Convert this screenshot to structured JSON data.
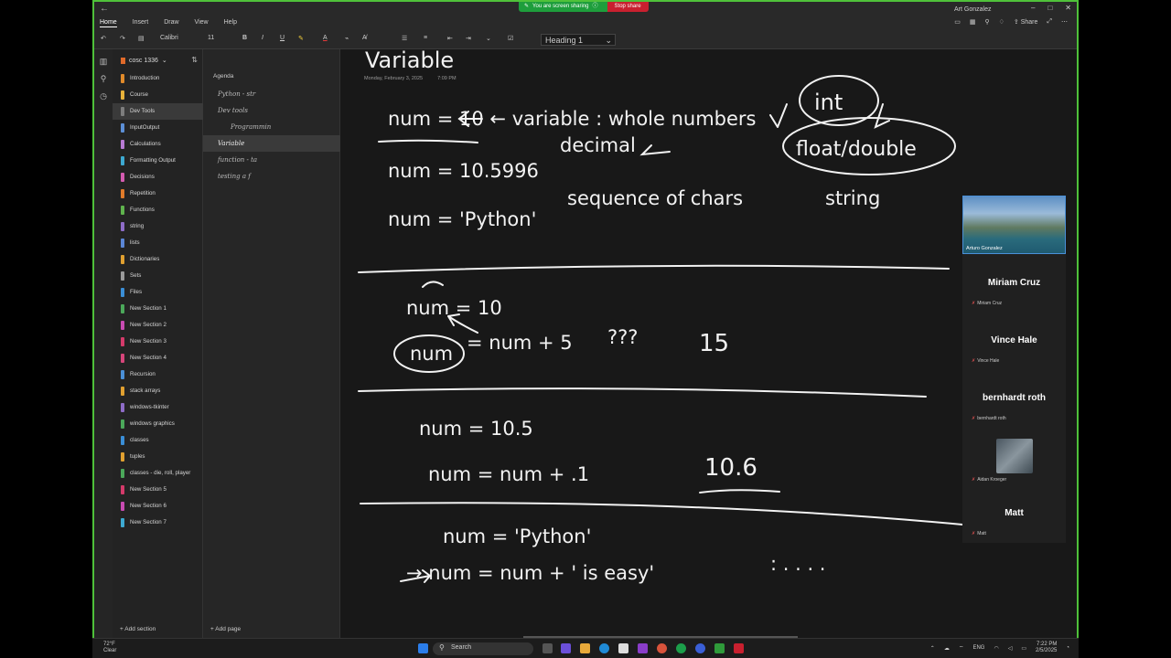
{
  "share_banner": {
    "message": "You are screen sharing",
    "stop": "Stop share"
  },
  "window": {
    "user": "Art Gonzalez",
    "controls": [
      "–",
      "□",
      "✕"
    ]
  },
  "menu": [
    "Home",
    "Insert",
    "Draw",
    "View",
    "Help"
  ],
  "top_right": {
    "share": "Share"
  },
  "ribbon": {
    "font": "Calibri",
    "size": "11",
    "style": "Heading 1"
  },
  "notebook": {
    "title": "cosc 1336"
  },
  "sections": [
    {
      "label": "Introduction",
      "color": "#e08a2a"
    },
    {
      "label": "Course",
      "color": "#e8b23a"
    },
    {
      "label": "Dev Tools",
      "color": "#7d7d7d",
      "selected": true
    },
    {
      "label": "InputOutput",
      "color": "#5c8fd6"
    },
    {
      "label": "Calculations",
      "color": "#b77ad3"
    },
    {
      "label": "Formatting Output",
      "color": "#3da9d1"
    },
    {
      "label": "Decisions",
      "color": "#d45bb0"
    },
    {
      "label": "Repetition",
      "color": "#e07b2a"
    },
    {
      "label": "Functions",
      "color": "#5fb34d"
    },
    {
      "label": "string",
      "color": "#8e6cc7"
    },
    {
      "label": "lists",
      "color": "#5b86d6"
    },
    {
      "label": "Dictionaries",
      "color": "#e0a030"
    },
    {
      "label": "Sets",
      "color": "#9a9a9a"
    },
    {
      "label": "Files",
      "color": "#3a8ed6"
    },
    {
      "label": "New Section 1",
      "color": "#4ba85a"
    },
    {
      "label": "New Section 2",
      "color": "#c84bb2"
    },
    {
      "label": "New Section 3",
      "color": "#d43a6a"
    },
    {
      "label": "New Section 4",
      "color": "#d6457a"
    },
    {
      "label": "Recursion",
      "color": "#4a8fd6"
    },
    {
      "label": "stack arrays",
      "color": "#e0a030"
    },
    {
      "label": "windows-tkinter",
      "color": "#8e6cc7"
    },
    {
      "label": "windows graphics",
      "color": "#4ba85a"
    },
    {
      "label": "classes",
      "color": "#3a8ed6"
    },
    {
      "label": "tuples",
      "color": "#e0a030"
    },
    {
      "label": "classes - die, roll, player",
      "color": "#4ba85a"
    },
    {
      "label": "New Section 5",
      "color": "#d43a6a"
    },
    {
      "label": "New Section 6",
      "color": "#c84bb2"
    },
    {
      "label": "New Section 7",
      "color": "#3da9d1"
    }
  ],
  "add_section": "Add section",
  "pages_header": "Agenda",
  "pages": [
    {
      "label": "Python - str",
      "indent": 1
    },
    {
      "label": "Dev tools",
      "indent": 1
    },
    {
      "label": "Programmin",
      "indent": 2
    },
    {
      "label": "Variable",
      "indent": 1,
      "selected": true
    },
    {
      "label": "function - ta",
      "indent": 1
    },
    {
      "label": "testing a f",
      "indent": 1
    }
  ],
  "add_page": "Add page",
  "note": {
    "title": "Variable",
    "date": "Monday, February 3, 2025",
    "time": "7:09 PM",
    "ink": {
      "l1": "num = 10  ←  variable : whole numbers",
      "int": "int",
      "l2": "num = 10.5996",
      "decimal": "decimal",
      "float": "float/double",
      "l3": "num = 'Python'",
      "chars": "sequence of chars",
      "string": "string",
      "l4": "num = 10",
      "l5a": "num",
      "l5b": "= num + 5",
      "q": "???",
      "r15": "15",
      "l6": "num = 10.5",
      "l7": "num = num + .1",
      "r106": "10.6",
      "l8": "num = 'Python'",
      "l9": "→ num = num + ' is easy'",
      "dots": ":   . . . ."
    }
  },
  "participants": {
    "video_name": "Arturo Gonzalez",
    "people": [
      {
        "big": "Miriam Cruz",
        "small": "Miriam Cruz"
      },
      {
        "big": "Vince Hale",
        "small": "Vince Hale"
      },
      {
        "big": "bernhardt roth",
        "small": "bernhardt roth"
      },
      {
        "big": "",
        "small": "Aidan Kroeger"
      },
      {
        "big": "Matt",
        "small": "Matt"
      }
    ]
  },
  "taskbar": {
    "temp": "72°F",
    "weather": "Clear",
    "search": "Search",
    "lang": "ENG",
    "time": "7:22 PM",
    "date": "2/5/2025"
  }
}
